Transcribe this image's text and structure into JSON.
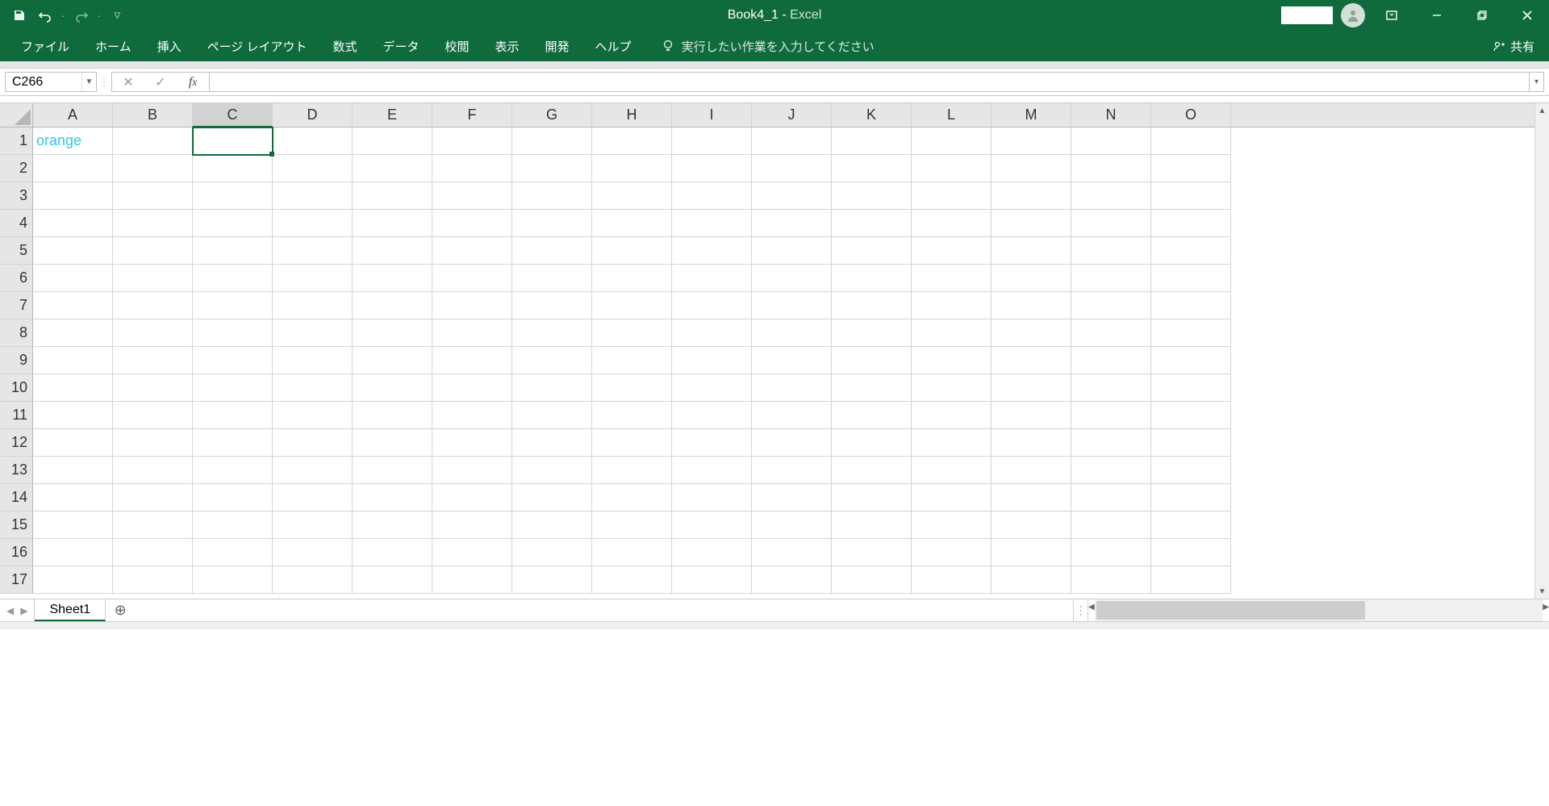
{
  "title": {
    "doc": "Book4_1",
    "sep": " - ",
    "app": "Excel"
  },
  "tabs": [
    "ファイル",
    "ホーム",
    "挿入",
    "ページ レイアウト",
    "数式",
    "データ",
    "校閲",
    "表示",
    "開発",
    "ヘルプ"
  ],
  "tell_me": "実行したい作業を入力してください",
  "share": "共有",
  "name_box": "C266",
  "formula": "",
  "columns": [
    "A",
    "B",
    "C",
    "D",
    "E",
    "F",
    "G",
    "H",
    "I",
    "J",
    "K",
    "L",
    "M",
    "N",
    "O"
  ],
  "selected_col": "C",
  "rows": [
    "1",
    "2",
    "3",
    "4",
    "5",
    "6",
    "7",
    "8",
    "9",
    "10",
    "11",
    "12",
    "13",
    "14",
    "15",
    "16",
    "17"
  ],
  "cells": {
    "A1": "orange"
  },
  "sheet_tab": "Sheet1"
}
